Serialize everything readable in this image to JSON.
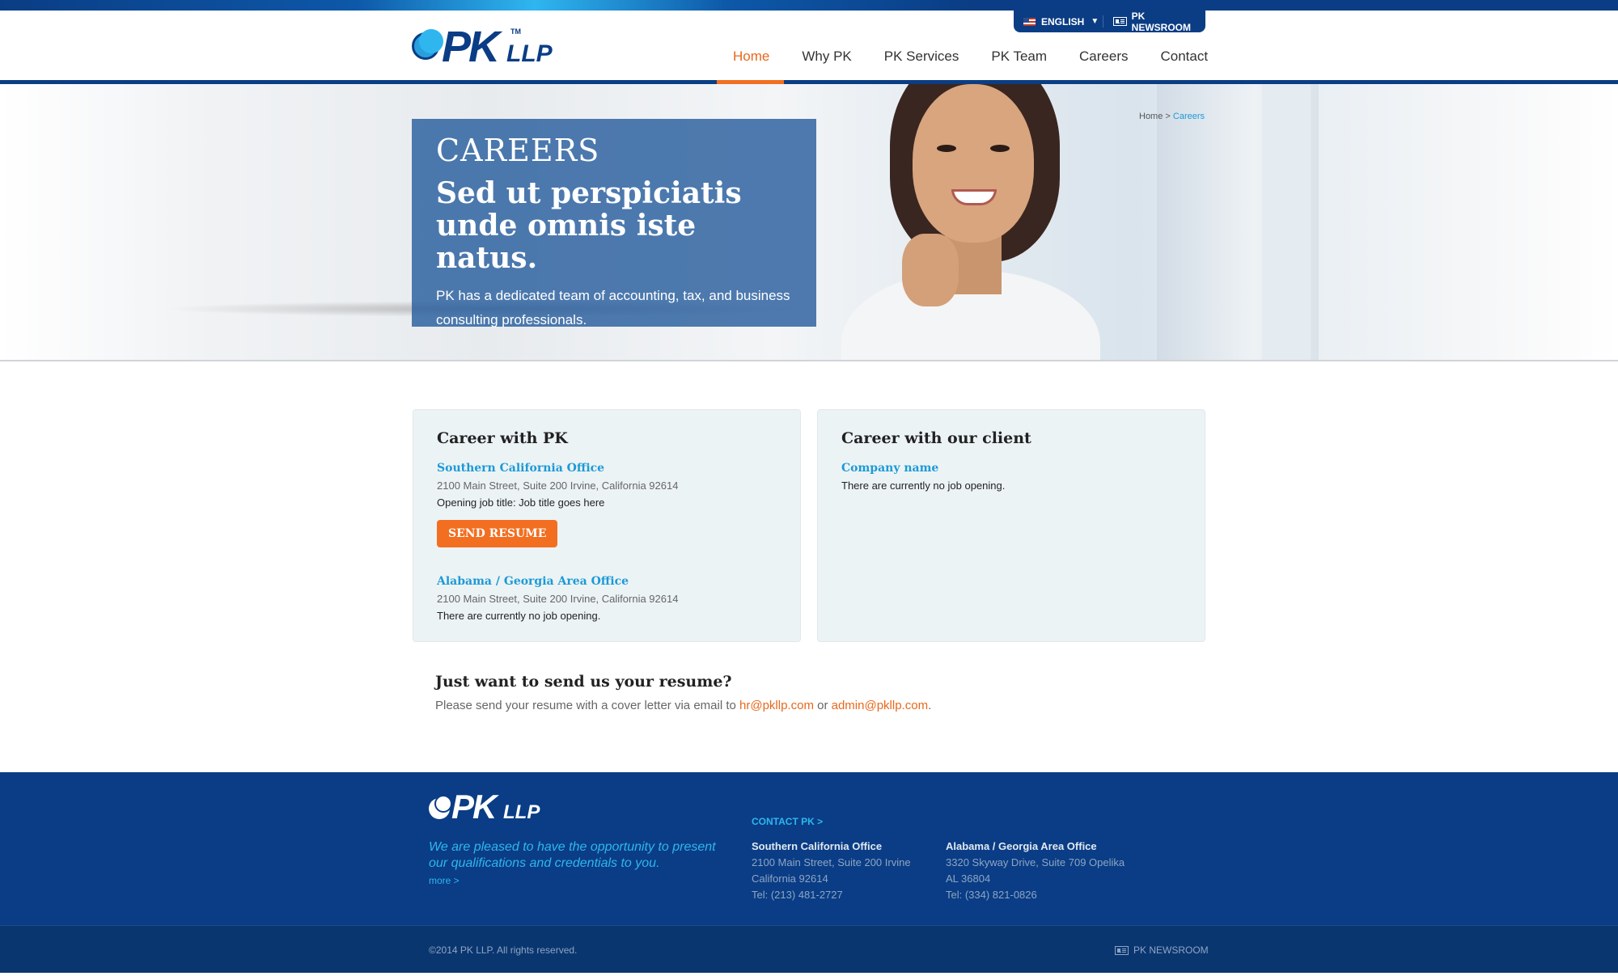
{
  "header": {
    "language": "ENGLISH",
    "newsroom": "PK NEWSROOM",
    "logo_text": "PK",
    "logo_suffix": "LLP",
    "logo_tm": "TM"
  },
  "nav": {
    "items": [
      {
        "label": "Home",
        "active": true
      },
      {
        "label": "Why PK",
        "active": false
      },
      {
        "label": "PK Services",
        "active": false
      },
      {
        "label": "PK Team",
        "active": false
      },
      {
        "label": "Careers",
        "active": false
      },
      {
        "label": "Contact",
        "active": false
      }
    ]
  },
  "breadcrumb": {
    "home": "Home",
    "sep": ">",
    "current": "Careers"
  },
  "hero": {
    "small_title": "CAREERS",
    "title": "Sed ut perspiciatis unde omnis iste natus.",
    "text": "PK has a dedicated team of accounting, tax, and business consulting professionals."
  },
  "career_pk": {
    "heading": "Career with PK",
    "offices": [
      {
        "name": "Southern California Office",
        "address": "2100 Main Street, Suite 200 Irvine, California 92614",
        "line": "Opening job title: Job title goes here",
        "button": "SEND RESUME"
      },
      {
        "name": "Alabama / Georgia Area Office",
        "address": "2100 Main Street, Suite 200 Irvine, California 92614",
        "line": "There are currently no job opening."
      }
    ]
  },
  "career_client": {
    "heading": "Career with our client",
    "company": "Company name",
    "line": "There are currently no job opening."
  },
  "resume": {
    "heading": "Just want to send us your resume?",
    "text": "Please send your resume with a cover letter via email to",
    "email1": "hr@pkllp.com",
    "or": "or",
    "email2": "admin@pkllp.com",
    "period": "."
  },
  "footer": {
    "tagline": "We are pleased to have the opportunity to present our qualifications and credentials to you.",
    "more": "more >",
    "contact": "CONTACT PK >",
    "office1": {
      "name": "Southern California Office",
      "line1": "2100 Main Street, Suite 200 Irvine",
      "line2": "California 92614",
      "tel": "Tel: (213) 481-2727"
    },
    "office2": {
      "name": "Alabama / Georgia Area Office",
      "line1": "3320 Skyway Drive, Suite 709 Opelika",
      "line2": "AL 36804",
      "tel": "Tel: (334) 821-0826"
    },
    "copyright": "©2014 PK LLP. All rights reserved.",
    "newsroom": "PK NEWSROOM"
  },
  "colors": {
    "brand_blue": "#0a3d85",
    "accent_orange": "#f26f21",
    "link_blue": "#1c9ad6"
  },
  "icons": [
    "us-flag-icon",
    "caret-down-icon",
    "newsroom-icon"
  ]
}
